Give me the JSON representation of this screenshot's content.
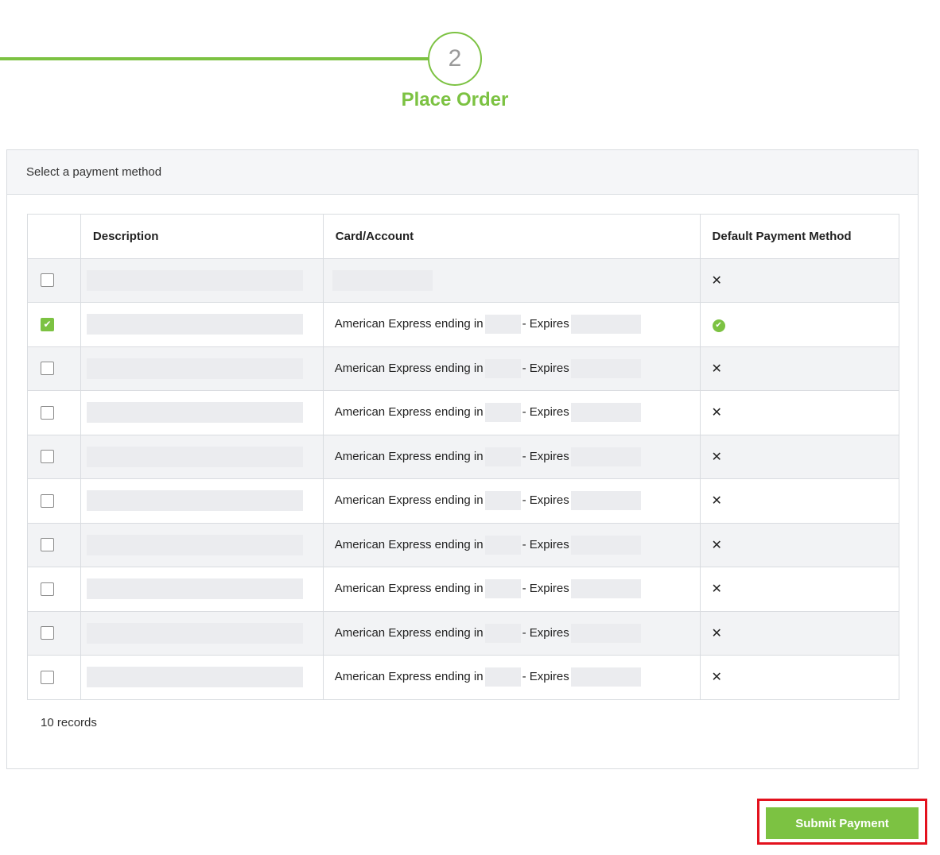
{
  "stepper": {
    "step_number": "2",
    "step_label": "Place Order",
    "accent_color": "#7cc242"
  },
  "panel": {
    "header": "Select a payment method",
    "columns": [
      "",
      "Description",
      "Card/Account",
      "Default Payment Method"
    ],
    "rows": [
      {
        "checked": false,
        "card_prefix": "",
        "card_suffix": "",
        "is_default": false,
        "default_icon": "x-icon"
      },
      {
        "checked": true,
        "card_prefix": "American Express ending in",
        "card_suffix": "- Expires",
        "is_default": true,
        "default_icon": "check-circle-icon"
      },
      {
        "checked": false,
        "card_prefix": "American Express ending in",
        "card_suffix": "- Expires",
        "is_default": false,
        "default_icon": "x-icon"
      },
      {
        "checked": false,
        "card_prefix": "American Express ending in",
        "card_suffix": "- Expires",
        "is_default": false,
        "default_icon": "x-icon"
      },
      {
        "checked": false,
        "card_prefix": "American Express ending in",
        "card_suffix": "- Expires",
        "is_default": false,
        "default_icon": "x-icon"
      },
      {
        "checked": false,
        "card_prefix": "American Express ending in",
        "card_suffix": "- Expires",
        "is_default": false,
        "default_icon": "x-icon"
      },
      {
        "checked": false,
        "card_prefix": "American Express ending in",
        "card_suffix": "- Expires",
        "is_default": false,
        "default_icon": "x-icon"
      },
      {
        "checked": false,
        "card_prefix": "American Express ending in",
        "card_suffix": "- Expires",
        "is_default": false,
        "default_icon": "x-icon"
      },
      {
        "checked": false,
        "card_prefix": "American Express ending in",
        "card_suffix": "- Expires",
        "is_default": false,
        "default_icon": "x-icon"
      },
      {
        "checked": false,
        "card_prefix": "American Express ending in",
        "card_suffix": "- Expires",
        "is_default": false,
        "default_icon": "x-icon"
      }
    ],
    "records_label": "10 records"
  },
  "actions": {
    "submit_label": "Submit Payment",
    "highlight_color": "#e3121e"
  },
  "glyphs": {
    "x": "✕",
    "check": "✔"
  }
}
